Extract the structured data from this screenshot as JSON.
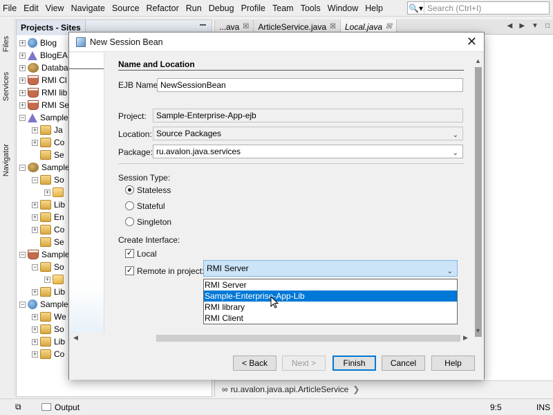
{
  "menubar": {
    "items": [
      "File",
      "Edit",
      "View",
      "Navigate",
      "Source",
      "Refactor",
      "Run",
      "Debug",
      "Profile",
      "Team",
      "Tools",
      "Window",
      "Help"
    ],
    "search_placeholder": "Search (Ctrl+I)"
  },
  "left_strip": {
    "files": "Files",
    "services": "Services",
    "navigator": "Navigator"
  },
  "projects": {
    "title": "Projects - Sites",
    "rows": [
      {
        "label": "Blog",
        "icon": "globe-icon",
        "indent": 0,
        "expander": "+"
      },
      {
        "label": "BlogEA",
        "icon": "triangle-icon",
        "indent": 0,
        "expander": "+"
      },
      {
        "label": "Databa",
        "icon": "bean-icon",
        "indent": 0,
        "expander": "+"
      },
      {
        "label": "RMI Cl",
        "icon": "coffee-cup-icon",
        "indent": 0,
        "expander": "+"
      },
      {
        "label": "RMI lib",
        "icon": "coffee-cup-icon",
        "indent": 0,
        "expander": "+"
      },
      {
        "label": "RMI Se",
        "icon": "coffee-cup-icon",
        "indent": 0,
        "expander": "+"
      },
      {
        "label": "Sample",
        "icon": "triangle-icon",
        "indent": 0,
        "expander": "−"
      },
      {
        "label": "Ja",
        "icon": "package-icon",
        "indent": 1,
        "expander": "+"
      },
      {
        "label": "Co",
        "icon": "package-icon",
        "indent": 1,
        "expander": "+"
      },
      {
        "label": "Se",
        "icon": "package-icon",
        "indent": 1,
        "expander": ""
      },
      {
        "label": "Sample",
        "icon": "bean-icon",
        "indent": 0,
        "expander": "−"
      },
      {
        "label": "So",
        "icon": "package-icon",
        "indent": 1,
        "expander": "−"
      },
      {
        "label": "",
        "icon": "folder-icon",
        "indent": 2,
        "expander": "+"
      },
      {
        "label": "Lib",
        "icon": "package-icon",
        "indent": 1,
        "expander": "+"
      },
      {
        "label": "En",
        "icon": "package-icon",
        "indent": 1,
        "expander": "+"
      },
      {
        "label": "Co",
        "icon": "package-icon",
        "indent": 1,
        "expander": "+"
      },
      {
        "label": "Se",
        "icon": "package-icon",
        "indent": 1,
        "expander": ""
      },
      {
        "label": "Sample",
        "icon": "coffee-cup-icon",
        "indent": 0,
        "expander": "−"
      },
      {
        "label": "So",
        "icon": "package-icon",
        "indent": 1,
        "expander": "−"
      },
      {
        "label": "",
        "icon": "folder-icon",
        "indent": 2,
        "expander": "+"
      },
      {
        "label": "Lib",
        "icon": "package-icon",
        "indent": 1,
        "expander": "+"
      },
      {
        "label": "Sample",
        "icon": "globe-icon",
        "indent": 0,
        "expander": "−"
      },
      {
        "label": "We",
        "icon": "package-icon",
        "indent": 1,
        "expander": "+"
      },
      {
        "label": "So",
        "icon": "package-icon",
        "indent": 1,
        "expander": "+"
      },
      {
        "label": "Lib",
        "icon": "package-icon",
        "indent": 1,
        "expander": "+"
      },
      {
        "label": "Co",
        "icon": "package-icon",
        "indent": 1,
        "expander": "+"
      }
    ]
  },
  "editor": {
    "tabs": [
      {
        "label": "...ava",
        "active": false
      },
      {
        "label": "ArticleService.java",
        "active": false
      },
      {
        "label": "Local.java",
        "active": true
      }
    ],
    "breadcrumb": "ru.avalon.java.api.ArticleService"
  },
  "statusbar": {
    "output": "Output",
    "position": "9:5",
    "mode": "INS"
  },
  "dialog": {
    "title": "New Session Bean",
    "section_title": "Name and Location",
    "ejb_name_label": "EJB Name:",
    "ejb_name_value": "NewSessionBean",
    "project_label": "Project:",
    "project_value": "Sample-Enterprise-App-ejb",
    "location_label": "Location:",
    "location_value": "Source Packages",
    "package_label": "Package:",
    "package_value": "ru.avalon.java.services",
    "session_type_label": "Session Type:",
    "session_types": [
      {
        "label": "Stateless",
        "selected": true
      },
      {
        "label": "Stateful",
        "selected": false
      },
      {
        "label": "Singleton",
        "selected": false
      }
    ],
    "create_interface_label": "Create Interface:",
    "local_label": "Local",
    "local_checked": true,
    "remote_label": "Remote in project:",
    "remote_checked": true,
    "remote_selected": "RMI Server",
    "remote_options": [
      "RMI Server",
      "Sample-Enterprise-App-Lib",
      "RMI library",
      "RMI Client"
    ],
    "remote_highlighted": "Sample-Enterprise-App-Lib",
    "buttons": {
      "back": "< Back",
      "next": "Next >",
      "finish": "Finish",
      "cancel": "Cancel",
      "help": "Help"
    }
  },
  "colors": {
    "selection": "#0078d7",
    "combo_active": "#cce4f7"
  }
}
